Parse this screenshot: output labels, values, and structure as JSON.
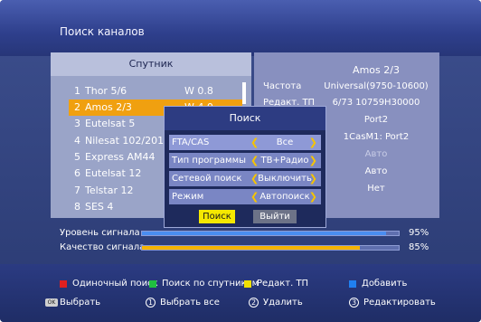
{
  "window": {
    "title": "Поиск каналов"
  },
  "satellite_list": {
    "header": "Спутник",
    "items": [
      {
        "num": "1",
        "name": "Thor 5/6",
        "value": "W  0.8"
      },
      {
        "num": "2",
        "name": "Amos 2/3",
        "value": "W  4.0"
      },
      {
        "num": "3",
        "name": "Eutelsat 5",
        "value": ""
      },
      {
        "num": "4",
        "name": "Nilesat 102/201",
        "value": ""
      },
      {
        "num": "5",
        "name": "Express AM44",
        "value": ""
      },
      {
        "num": "6",
        "name": "Eutelsat 12",
        "value": ""
      },
      {
        "num": "7",
        "name": "Telstar 12",
        "value": ""
      },
      {
        "num": "8",
        "name": "SES 4",
        "value": ""
      }
    ],
    "selected_index": 1
  },
  "info_panel": {
    "satellite_name": "Amos 2/3",
    "rows": [
      {
        "label": "Частота",
        "value": "Universal(9750-10600)"
      },
      {
        "label": "Редакт. ТП",
        "value": "6/73 10759H30000"
      },
      {
        "label": "",
        "value": "Port2"
      },
      {
        "label": "",
        "value": "1CasM1: Port2"
      },
      {
        "label": "",
        "value": "Авто"
      },
      {
        "label": "",
        "value": "Авто"
      },
      {
        "label": "",
        "value": "Нет"
      }
    ]
  },
  "dialog": {
    "title": "Поиск",
    "rows": [
      {
        "label": "FTA/CAS",
        "value": "Все"
      },
      {
        "label": "Тип программы",
        "value": "ТВ+Радио"
      },
      {
        "label": "Сетевой поиск",
        "value": "Выключить"
      },
      {
        "label": "Режим",
        "value": "Автопоиск"
      }
    ],
    "search_button": "Поиск",
    "exit_button": "Выйти"
  },
  "signal": {
    "level_label": "Уровень сигнала",
    "level_value": 0.95,
    "level_text": "95%",
    "quality_label": "Качество сигнала",
    "quality_value": 0.85,
    "quality_text": "85%"
  },
  "footer": {
    "red": "Одиночный поиск",
    "green": "Поиск по спутникам",
    "yellow": "Редакт. ТП",
    "blue": "Добавить",
    "ok_icon_text": "OK",
    "ok": "Выбрать",
    "key1_symbol": "1",
    "key1": "Выбрать все",
    "key2_symbol": "2",
    "key2": "Удалить",
    "key3_symbol": "3",
    "key3": "Редактировать"
  },
  "colors": {
    "red": "#e02020",
    "green": "#20c040",
    "yellow": "#f0e000",
    "blue": "#2080f0",
    "level_bar": "#4a8ef0",
    "quality_bar": "#f5b400",
    "selection": "#f0a010"
  }
}
